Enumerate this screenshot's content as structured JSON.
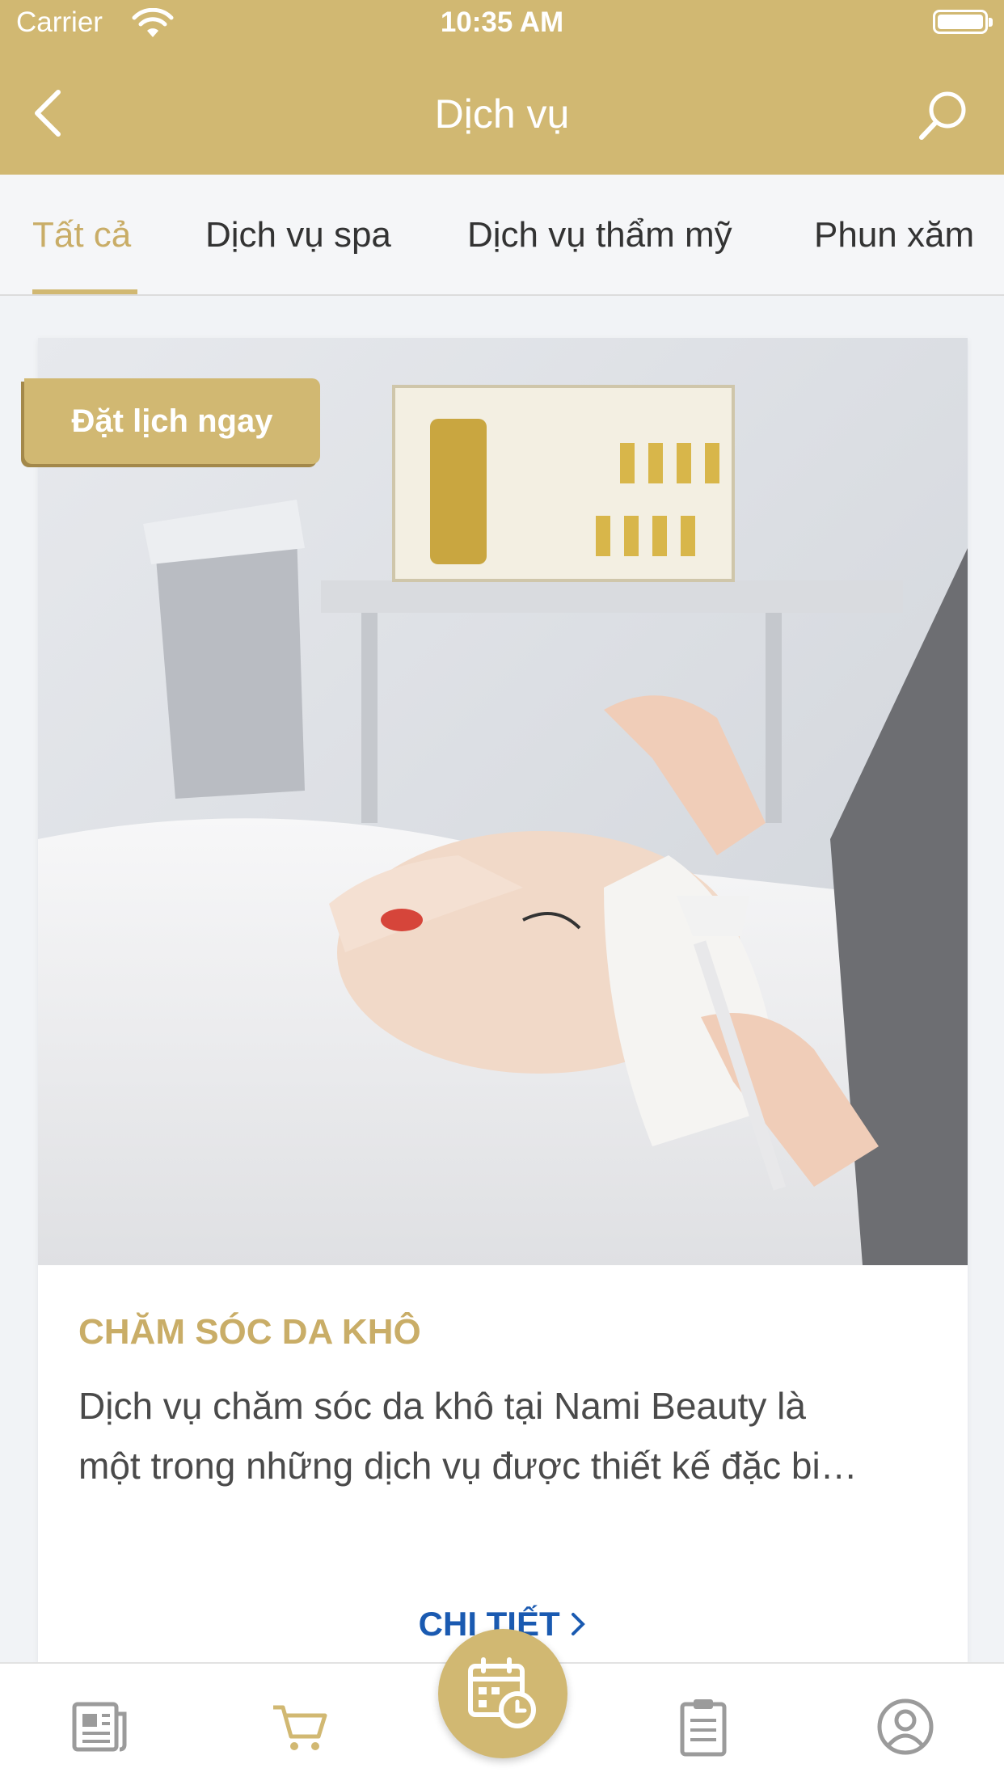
{
  "status_bar": {
    "carrier": "Carrier",
    "time": "10:35 AM"
  },
  "nav": {
    "title": "Dịch vụ",
    "back_icon": "chevron-left-icon",
    "search_icon": "search-icon"
  },
  "tabs": [
    {
      "label": "Tất cả",
      "active": true
    },
    {
      "label": "Dịch vụ spa",
      "active": false
    },
    {
      "label": "Dịch vụ thẩm mỹ",
      "active": false
    },
    {
      "label": "Phun xăm",
      "active": false
    }
  ],
  "card": {
    "badge": "Đặt lịch ngay",
    "title": "CHĂM SÓC DA KHÔ",
    "description_line1": "Dịch vụ chăm sóc da khô tại Nami Beauty là",
    "description_line2": "một trong những dịch vụ được thiết kế đặc bi…",
    "detail": "CHI TIẾT",
    "detail_icon": "chevron-right-icon"
  },
  "bottom_nav": [
    {
      "name": "news-icon"
    },
    {
      "name": "cart-icon",
      "active": true
    },
    {
      "name": "calendar-clock-icon",
      "center": true
    },
    {
      "name": "clipboard-icon"
    },
    {
      "name": "user-icon"
    }
  ],
  "colors": {
    "brand_gold": "#d1b872",
    "text_gold": "#c9ad67",
    "link_blue": "#1a5ab1"
  }
}
